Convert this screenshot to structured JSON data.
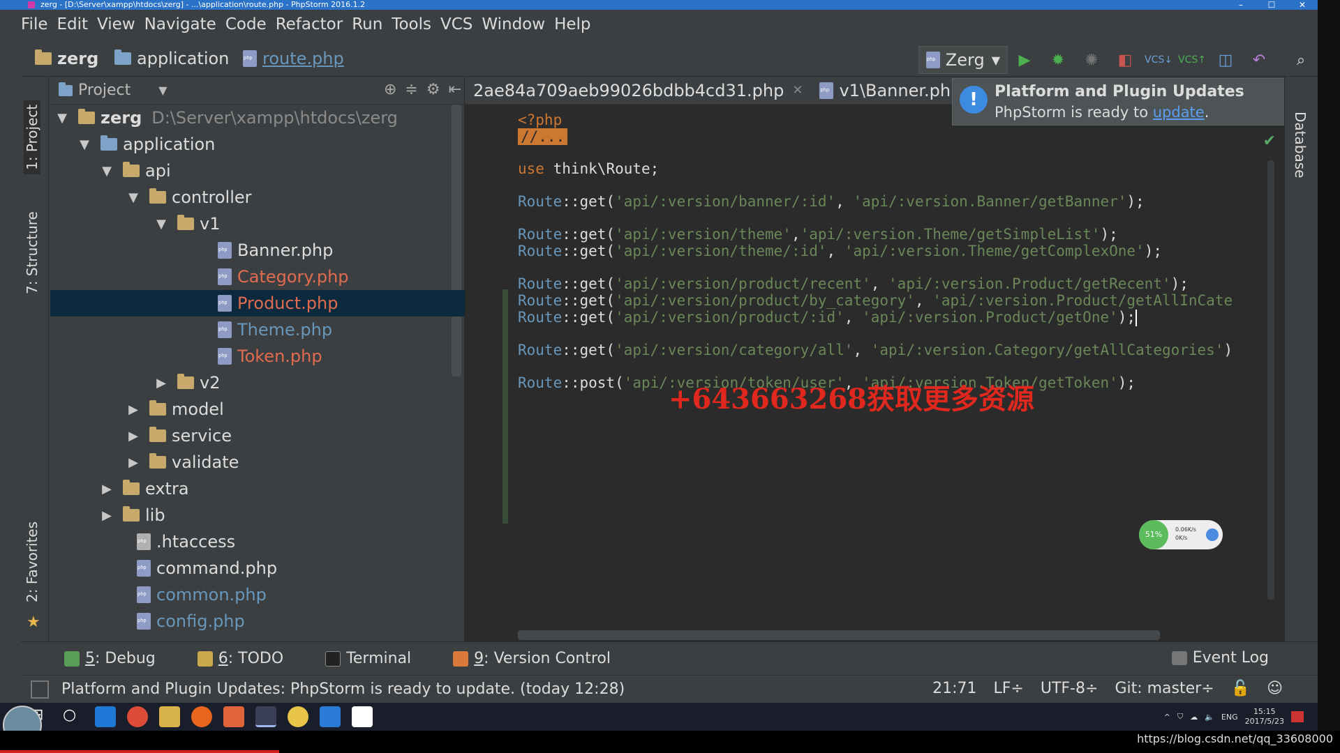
{
  "titlebar": {
    "title": "zerg - [D:\\Server\\xampp\\htdocs\\zerg] - ...\\application\\route.php - PhpStorm 2016.1.2",
    "min": "–",
    "max": "☐",
    "close": "✕"
  },
  "menu": [
    "File",
    "Edit",
    "View",
    "Navigate",
    "Code",
    "Refactor",
    "Run",
    "Tools",
    "VCS",
    "Window",
    "Help"
  ],
  "breadcrumb": {
    "project": "zerg",
    "folder": "application",
    "file": "route.php"
  },
  "run_config": {
    "name": "Zerg"
  },
  "left_tabs": {
    "project": "1: Project",
    "structure": "7: Structure",
    "favorites": "2: Favorites"
  },
  "right_tab": "Database",
  "project_panel": {
    "header": "Project",
    "tree": [
      {
        "name": "zerg",
        "path": "D:\\Server\\xampp\\htdocs\\zerg",
        "type": "folder"
      },
      {
        "name": "application",
        "type": "folder"
      },
      {
        "name": "api",
        "type": "folder"
      },
      {
        "name": "controller",
        "type": "folder"
      },
      {
        "name": "v1",
        "type": "folder"
      },
      {
        "name": "Banner.php",
        "type": "php"
      },
      {
        "name": "Category.php",
        "type": "php"
      },
      {
        "name": "Product.php",
        "type": "php"
      },
      {
        "name": "Theme.php",
        "type": "php"
      },
      {
        "name": "Token.php",
        "type": "php"
      },
      {
        "name": "v2",
        "type": "folder"
      },
      {
        "name": "model",
        "type": "folder"
      },
      {
        "name": "service",
        "type": "folder"
      },
      {
        "name": "validate",
        "type": "folder"
      },
      {
        "name": "extra",
        "type": "folder"
      },
      {
        "name": "lib",
        "type": "folder"
      },
      {
        "name": ".htaccess",
        "type": "file"
      },
      {
        "name": "command.php",
        "type": "php"
      },
      {
        "name": "common.php",
        "type": "php"
      },
      {
        "name": "config.php",
        "type": "php"
      }
    ]
  },
  "editor": {
    "tabs": [
      {
        "label": "2ae84a709aeb99026bdbb4cd31.php"
      },
      {
        "label": "v1\\Banner.php"
      }
    ],
    "code": {
      "php_open": "<?php",
      "fold": "//...",
      "use_kw": "use",
      "use_stmt": " think\\Route;",
      "routes": [
        {
          "cls": "Route",
          "method": "::get(",
          "a": "'api/:version/banner/:id'",
          "sep": ", ",
          "b": "'api/:version.Banner/getBanner'",
          "end": ");"
        },
        {
          "cls": "Route",
          "method": "::get(",
          "a": "'api/:version/theme'",
          "sep": ",",
          "b": "'api/:version.Theme/getSimpleList'",
          "end": ");"
        },
        {
          "cls": "Route",
          "method": "::get(",
          "a": "'api/:version/theme/:id'",
          "sep": ", ",
          "b": "'api/:version.Theme/getComplexOne'",
          "end": ");"
        },
        {
          "cls": "Route",
          "method": "::get(",
          "a": "'api/:version/product/recent'",
          "sep": ", ",
          "b": "'api/:version.Product/getRecent'",
          "end": ");"
        },
        {
          "cls": "Route",
          "method": "::get(",
          "a": "'api/:version/product/by_category'",
          "sep": ", ",
          "b": "'api/:version.Product/getAllInCate",
          "end": ""
        },
        {
          "cls": "Route",
          "method": "::get(",
          "a": "'api/:version/product/:id'",
          "sep": ", ",
          "b": "'api/:version.Product/getOne'",
          "end": ");"
        },
        {
          "cls": "Route",
          "method": "::get(",
          "a": "'api/:version/category/all'",
          "sep": ", ",
          "b": "'api/:version.Category/getAllCategories'",
          "end": ")"
        },
        {
          "cls": "Route",
          "method": "::post(",
          "a": "'api/:version/token/user'",
          "sep": ", ",
          "b": "'api/:version.Token/getToken'",
          "end": ");"
        }
      ]
    },
    "watermark": "+643663268获取更多资源"
  },
  "notification": {
    "title": "Platform and Plugin Updates",
    "body": "PhpStorm is ready to ",
    "link": "update",
    "tail": "."
  },
  "net_widget": {
    "percent": "51%",
    "up": "0.06K/s",
    "down": "0K/s"
  },
  "bottom_tools": {
    "debug_num": "5",
    "debug": ": Debug",
    "todo_num": "6",
    "todo": ": TODO",
    "terminal": "Terminal",
    "vc_num": "9",
    "vc": ": Version Control",
    "event_log": "Event Log"
  },
  "status": {
    "message": "Platform and Plugin Updates: PhpStorm is ready to update. (today 12:28)",
    "position": "21:71",
    "line_sep": "LF÷",
    "encoding": "UTF-8÷",
    "vcs": "Git: master÷"
  },
  "taskbar": {
    "lang": "ENG",
    "time": "15:15",
    "date": "2017/5/23"
  },
  "caption_url": "https://blog.csdn.net/qq_33608000"
}
